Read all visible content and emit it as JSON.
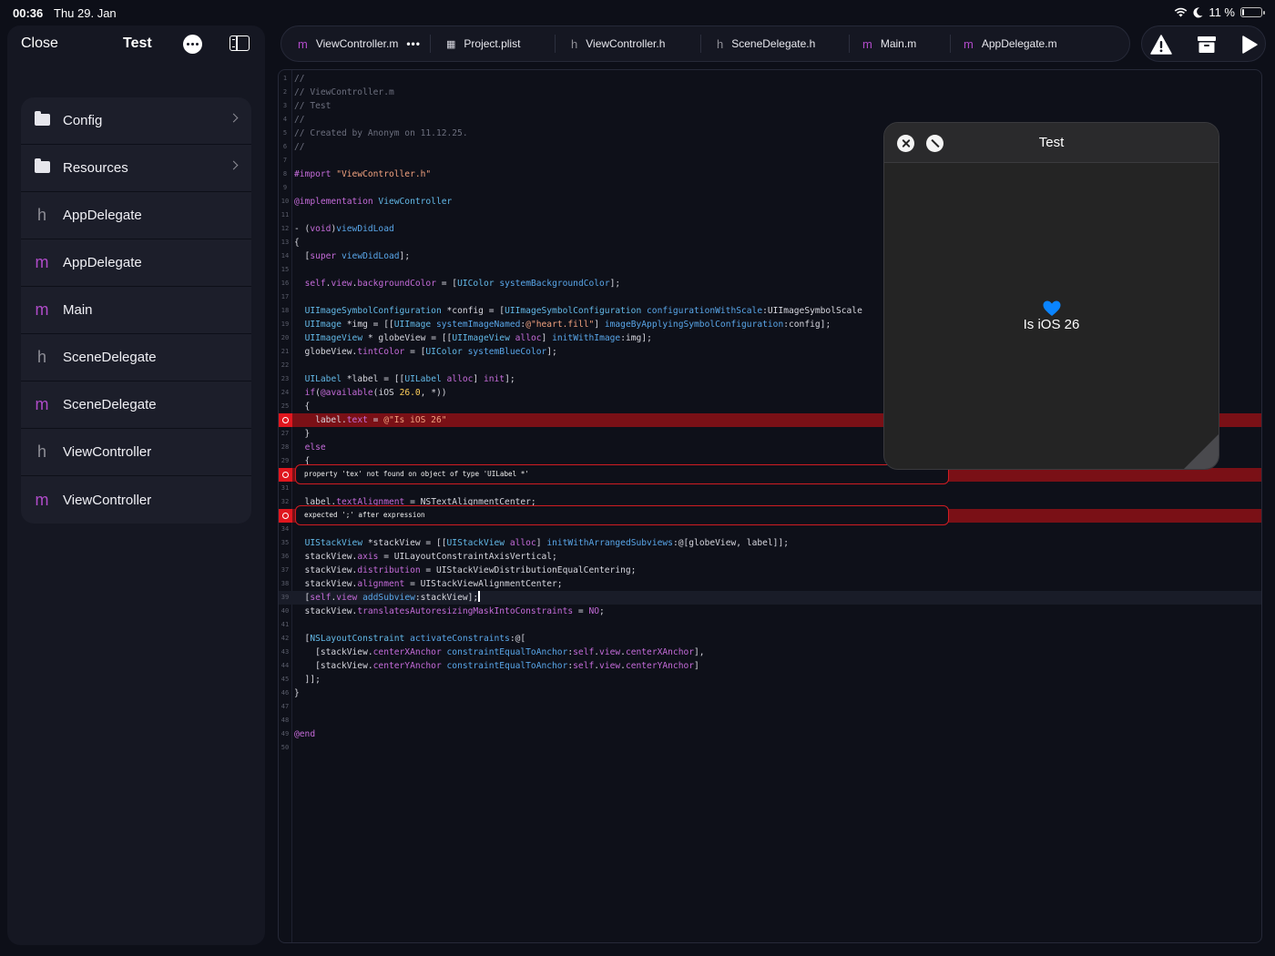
{
  "status_bar": {
    "time": "00:36",
    "date": "Thu 29. Jan",
    "battery": "11 %",
    "battery_level": 0.11
  },
  "sidebar": {
    "close_label": "Close",
    "project_title": "Test",
    "items": [
      {
        "type": "folder",
        "icon": "folder-icon",
        "label": "Config"
      },
      {
        "type": "folder",
        "icon": "folder-icon",
        "label": "Resources"
      },
      {
        "type": "h",
        "icon": "h",
        "label": "AppDelegate"
      },
      {
        "type": "m",
        "icon": "m",
        "label": "AppDelegate"
      },
      {
        "type": "m",
        "icon": "m",
        "label": "Main"
      },
      {
        "type": "h",
        "icon": "h",
        "label": "SceneDelegate"
      },
      {
        "type": "m",
        "icon": "m",
        "label": "SceneDelegate"
      },
      {
        "type": "h",
        "icon": "h",
        "label": "ViewController"
      },
      {
        "type": "m",
        "icon": "m",
        "label": "ViewController"
      }
    ]
  },
  "tabs": [
    {
      "icon": "m",
      "label": "ViewController.m",
      "more": "•••"
    },
    {
      "icon": "▦",
      "label": "Project.plist"
    },
    {
      "icon": "h",
      "label": "ViewController.h"
    },
    {
      "icon": "h",
      "label": "SceneDelegate.h"
    },
    {
      "icon": "m",
      "label": "Main.m"
    },
    {
      "icon": "m",
      "label": "AppDelegate.m"
    }
  ],
  "editor": {
    "lines": [
      {
        "n": "1",
        "code": "//"
      },
      {
        "n": "2",
        "code": "// ViewController.m"
      },
      {
        "n": "3",
        "code": "// Test"
      },
      {
        "n": "4",
        "code": "//"
      },
      {
        "n": "5",
        "code": "// Created by Anonym on 11.12.25."
      },
      {
        "n": "6",
        "code": "//"
      },
      {
        "n": "7",
        "code": ""
      },
      {
        "n": "8",
        "code": "#import \"ViewController.h\""
      },
      {
        "n": "9",
        "code": ""
      },
      {
        "n": "10",
        "code": "@implementation ViewController"
      },
      {
        "n": "11",
        "code": ""
      },
      {
        "n": "12",
        "code": "- (void)viewDidLoad"
      },
      {
        "n": "13",
        "code": "{"
      },
      {
        "n": "14",
        "code": "  [super viewDidLoad];"
      },
      {
        "n": "15",
        "code": ""
      },
      {
        "n": "16",
        "code": "  self.view.backgroundColor = [UIColor systemBackgroundColor];"
      },
      {
        "n": "17",
        "code": ""
      },
      {
        "n": "18",
        "code": "  UIImageSymbolConfiguration *config = [UIImageSymbolConfiguration configurationWithScale:UIImageSymbolScale"
      },
      {
        "n": "19",
        "code": "  UIImage *img = [[UIImage systemImageNamed:@\"heart.fill\"] imageByApplyingSymbolConfiguration:config];"
      },
      {
        "n": "20",
        "code": "  UIImageView * globeView = [[UIImageView alloc] initWithImage:img];"
      },
      {
        "n": "21",
        "code": "  globeView.tintColor = [UIColor systemBlueColor];"
      },
      {
        "n": "22",
        "code": ""
      },
      {
        "n": "23",
        "code": "  UILabel *label = [[UILabel alloc] init];"
      },
      {
        "n": "24",
        "code": "  if(@available(iOS 26.0, *))"
      },
      {
        "n": "25",
        "code": "  {"
      },
      {
        "n": "26",
        "code": "    label.text = @\"Is iOS 26\"",
        "error": true
      },
      {
        "n": "27",
        "code": "  }"
      },
      {
        "n": "28",
        "code": "  else"
      },
      {
        "n": "29",
        "code": "  {"
      },
      {
        "n": "30",
        "code": "",
        "error": true
      },
      {
        "n": "31",
        "code": ""
      },
      {
        "n": "32",
        "code": "  label.textAlignment = NSTextAlignmentCenter;"
      },
      {
        "n": "33",
        "code": "",
        "error": true
      },
      {
        "n": "34",
        "code": ""
      },
      {
        "n": "35",
        "code": "  UIStackView *stackView = [[UIStackView alloc] initWithArrangedSubviews:@[globeView, label]];"
      },
      {
        "n": "36",
        "code": "  stackView.axis = UILayoutConstraintAxisVertical;"
      },
      {
        "n": "37",
        "code": "  stackView.distribution = UIStackViewDistributionEqualCentering;"
      },
      {
        "n": "38",
        "code": "  stackView.alignment = UIStackViewAlignmentCenter;"
      },
      {
        "n": "39",
        "code": "  [self.view addSubview:stackView];",
        "current": true
      },
      {
        "n": "40",
        "code": "  stackView.translatesAutoresizingMaskIntoConstraints = NO;"
      },
      {
        "n": "41",
        "code": ""
      },
      {
        "n": "42",
        "code": "  [NSLayoutConstraint activateConstraints:@["
      },
      {
        "n": "43",
        "code": "    [stackView.centerXAnchor constraintEqualToAnchor:self.view.centerXAnchor],"
      },
      {
        "n": "44",
        "code": "    [stackView.centerYAnchor constraintEqualToAnchor:self.view.centerYAnchor]"
      },
      {
        "n": "45",
        "code": "  ]];"
      },
      {
        "n": "46",
        "code": "}"
      },
      {
        "n": "47",
        "code": ""
      },
      {
        "n": "48",
        "code": ""
      },
      {
        "n": "49",
        "code": "@end"
      },
      {
        "n": "50",
        "code": ""
      }
    ],
    "errors": [
      {
        "line": "30",
        "message": "property 'tex' not found on object of type 'UILabel *'"
      },
      {
        "line": "33",
        "message": "expected ';' after expression"
      }
    ]
  },
  "preview": {
    "title": "Test",
    "label": "Is iOS 26",
    "heart_color": "#0a84ff"
  },
  "colors": {
    "error": "#e0161e",
    "accent_m": "#b04bc9",
    "background": "#0d0f18"
  }
}
